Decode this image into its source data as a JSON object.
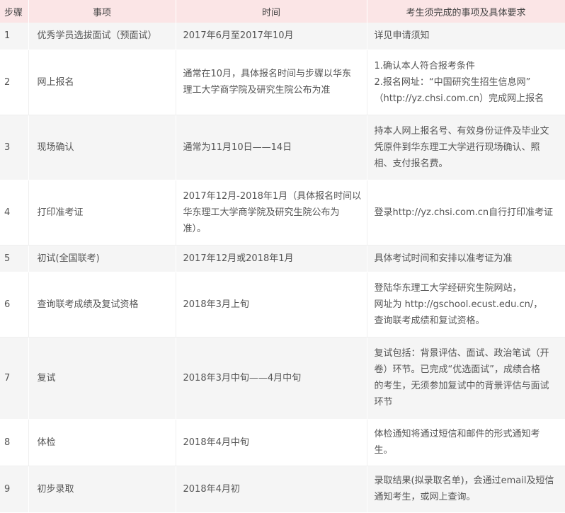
{
  "headers": [
    "步骤",
    "事项",
    "时间",
    "考生须完成的事项及具体要求"
  ],
  "rows": [
    {
      "step": "1",
      "item": "优秀学员选拔面试（预面试）",
      "time": [
        "2017年6月至2017年10月"
      ],
      "req": [
        "详见申请须知"
      ]
    },
    {
      "step": "2",
      "item": "网上报名",
      "time": [
        "通常在10月，具体报名时间与步骤以华东",
        "理工大学商学院及研究生院公布为准"
      ],
      "req": [
        "1.确认本人符合报考条件",
        "2.报名网址：“中国研究生招生信息网”",
        "（http://yz.chsi.com.cn）完成网上报名"
      ]
    },
    {
      "step": "3",
      "item": "现场确认",
      "time": [
        "通常为11月10日——14日"
      ],
      "req": [
        "持本人网上报名号、有效身份证件及毕业文",
        "凭原件到华东理工大学进行现场确认、照",
        "相、支付报名费。"
      ]
    },
    {
      "step": "4",
      "item": "打印准考证",
      "time": [
        "2017年12月-2018年1月（具体报名时间以",
        "华东理工大学商学院及研究生院公布为",
        "准）。"
      ],
      "req": [
        "登录http://yz.chsi.com.cn自行打印准考证"
      ]
    },
    {
      "step": "5",
      "item": "初试(全国联考)",
      "time": [
        "2017年12月或2018年1月"
      ],
      "req": [
        "具体考试时间和安排以准考证为准"
      ]
    },
    {
      "step": "6",
      "item": "查询联考成绩及复试资格",
      "time": [
        "2018年3月上旬"
      ],
      "req": [
        "登陆华东理工大学经研究生院网站，",
        "网址为 http://gschool.ecust.edu.cn/，",
        "查询联考成绩和复试资格。"
      ]
    },
    {
      "step": "7",
      "item": "复试",
      "time": [
        "2018年3月中旬——4月中旬"
      ],
      "req": [
        "复试包括：背景评估、面试、政治笔试（开",
        "卷）环节。已完成“优选面试”，成绩合格",
        "的考生，无须参加复试中的背景评估与面试",
        "环节"
      ]
    },
    {
      "step": "8",
      "item": "体检",
      "time": [
        "2018年4月中旬"
      ],
      "req": [
        "体检通知将通过短信和邮件的形式通知考",
        "生。"
      ]
    },
    {
      "step": "9",
      "item": "初步录取",
      "time": [
        "2018年4月初"
      ],
      "req": [
        "录取结果(拟录取名单)，会通过email及短信",
        "通知考生，或网上查询。"
      ]
    }
  ]
}
